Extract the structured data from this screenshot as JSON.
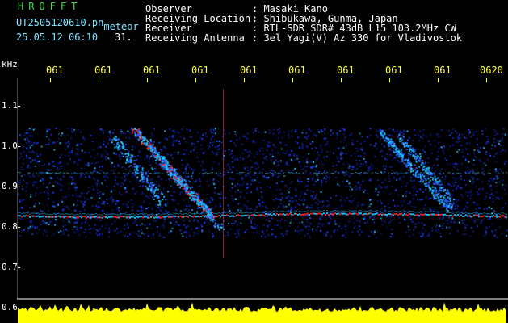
{
  "header": {
    "app_title": "HROFFT",
    "filename": "UT2505120610.pn",
    "filename_suffix": "meteor",
    "datetime": "25.05.12 06:10",
    "count": "31.",
    "fields": [
      {
        "label": "Observer",
        "value": ": Masaki Kano"
      },
      {
        "label": "Receiving Location",
        "value": ": Shibukawa, Gunma, Japan"
      },
      {
        "label": "Receiver",
        "value": ": RTL-SDR SDR# 43dB L15 103.2MHz CW"
      },
      {
        "label": "Receiving Antenna",
        "value": ": 3el Yagi(V) Az 330 for Vladivostok"
      }
    ]
  },
  "axes": {
    "y_unit": "kHz",
    "x_ticks": [
      "061",
      "061",
      "061",
      "061",
      "061",
      "061",
      "061",
      "061",
      "061",
      "0620"
    ],
    "y_ticks": [
      "1.1",
      "1.0",
      "0.9",
      "0.8",
      "0.7",
      "0.6"
    ]
  },
  "colors": {
    "background": "#000000",
    "tick_color": "#ffff33",
    "title_color": "#39e04a",
    "signal_weak": "#0a1fa0",
    "signal_mid": "#19c8ff",
    "signal_strong": "#ff2020",
    "level_trace": "#ffff00"
  }
}
